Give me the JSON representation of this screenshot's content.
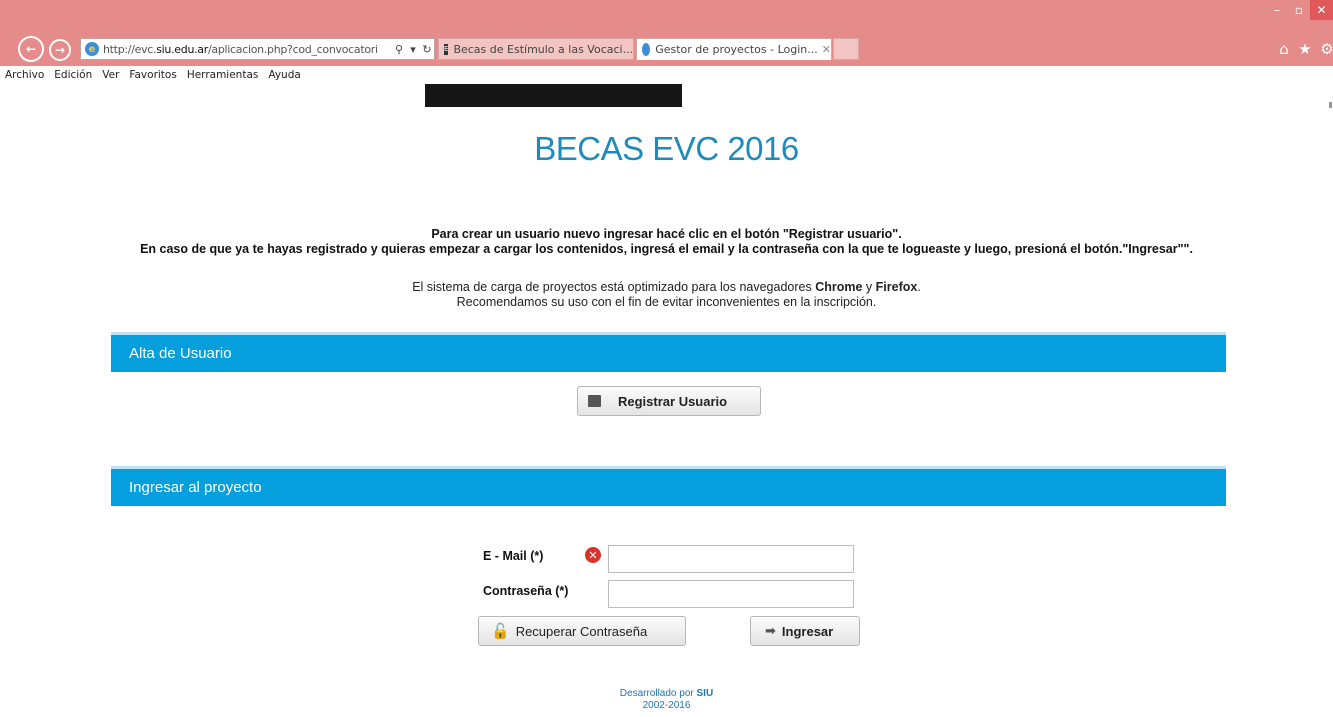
{
  "browser": {
    "address_url_prefix": "http://evc.",
    "address_url_domain": "siu.edu.ar",
    "address_url_rest": "/aplicacion.php?cod_convocatori",
    "tabs": [
      {
        "label": "Becas de Estímulo a las Vocaci...",
        "active": false
      },
      {
        "label": "Gestor de proyectos - Login...",
        "active": true
      }
    ],
    "menu": [
      "Archivo",
      "Edición",
      "Ver",
      "Favoritos",
      "Herramientas",
      "Ayuda"
    ],
    "icons": {
      "back": "back-arrow-icon",
      "forward": "forward-arrow-icon",
      "home": "home-icon",
      "favorites": "star-icon",
      "settings": "gear-icon"
    },
    "colors": {
      "chrome": "#e58b89"
    }
  },
  "page": {
    "title": "BECAS EVC 2016",
    "instructions": [
      "Para crear un usuario nuevo ingresar hacé clic en el botón \"Registrar usuario\".",
      "En caso de que ya te hayas registrado y quieras empezar a cargar los contenidos, ingresá el email y la contraseña con la que te logueaste y luego, presioná el botón.\"Ingresar\"\"."
    ],
    "browser_note": {
      "prefix": "El sistema de carga de proyectos está optimizado para los navegadores ",
      "browser1": "Chrome",
      "conj": " y ",
      "browser2": "Firefox",
      "suffix": ".",
      "line2": "Recomendamos su uso con el fin de evitar inconvenientes en la inscripción."
    },
    "alta_section": {
      "title": "Alta de Usuario",
      "register_button": "Registrar Usuario"
    },
    "login_section": {
      "title": "Ingresar al proyecto",
      "email_label": "E - Mail (*)",
      "email_value": "",
      "email_error": true,
      "password_label": "Contraseña (*)",
      "password_value": "",
      "recover_button": "Recuperar Contraseña",
      "login_button": "Ingresar"
    },
    "footer": {
      "developed_by": "Desarrollado por ",
      "org": "SIU",
      "years": "2002-2016"
    },
    "colors": {
      "accent": "#069fde",
      "title": "#1f8bba",
      "error": "#d9332b"
    }
  }
}
